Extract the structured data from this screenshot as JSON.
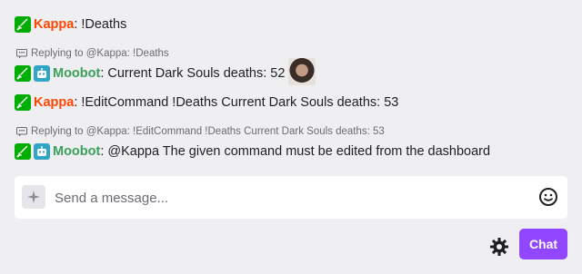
{
  "messages": [
    {
      "badges": [
        "sword-icon"
      ],
      "user": "Kappa",
      "separator": ":",
      "text": "!Deaths"
    },
    {
      "reply": "Replying to @Kappa: !Deaths",
      "badges": [
        "sword-icon",
        "bot-icon"
      ],
      "user": "Moobot",
      "separator": ":",
      "text": "Current Dark Souls deaths: 52",
      "emote": "facepalm-emote"
    },
    {
      "badges": [
        "sword-icon"
      ],
      "user": "Kappa",
      "separator": ":",
      "text": "!EditCommand !Deaths Current Dark Souls deaths: 53"
    },
    {
      "reply": "Replying to @Kappa: !EditCommand !Deaths Current Dark Souls deaths: 53",
      "badges": [
        "sword-icon",
        "bot-icon"
      ],
      "user": "Moobot",
      "separator": ":",
      "text": "@Kappa The given command must be edited from the dashboard"
    }
  ],
  "composer": {
    "placeholder": "Send a message...",
    "left_icon": "sparkle-icon",
    "emoji_icon": "smiley-icon"
  },
  "footer": {
    "settings_icon": "gear-icon",
    "chat_button_label": "Chat"
  },
  "colors": {
    "background": "#efeff1",
    "kappa": "#ff4500",
    "moobot": "#3ba05b",
    "mod_badge": "#00ad03",
    "bot_badge": "#31a6c4",
    "chat_button": "#9147ff"
  }
}
